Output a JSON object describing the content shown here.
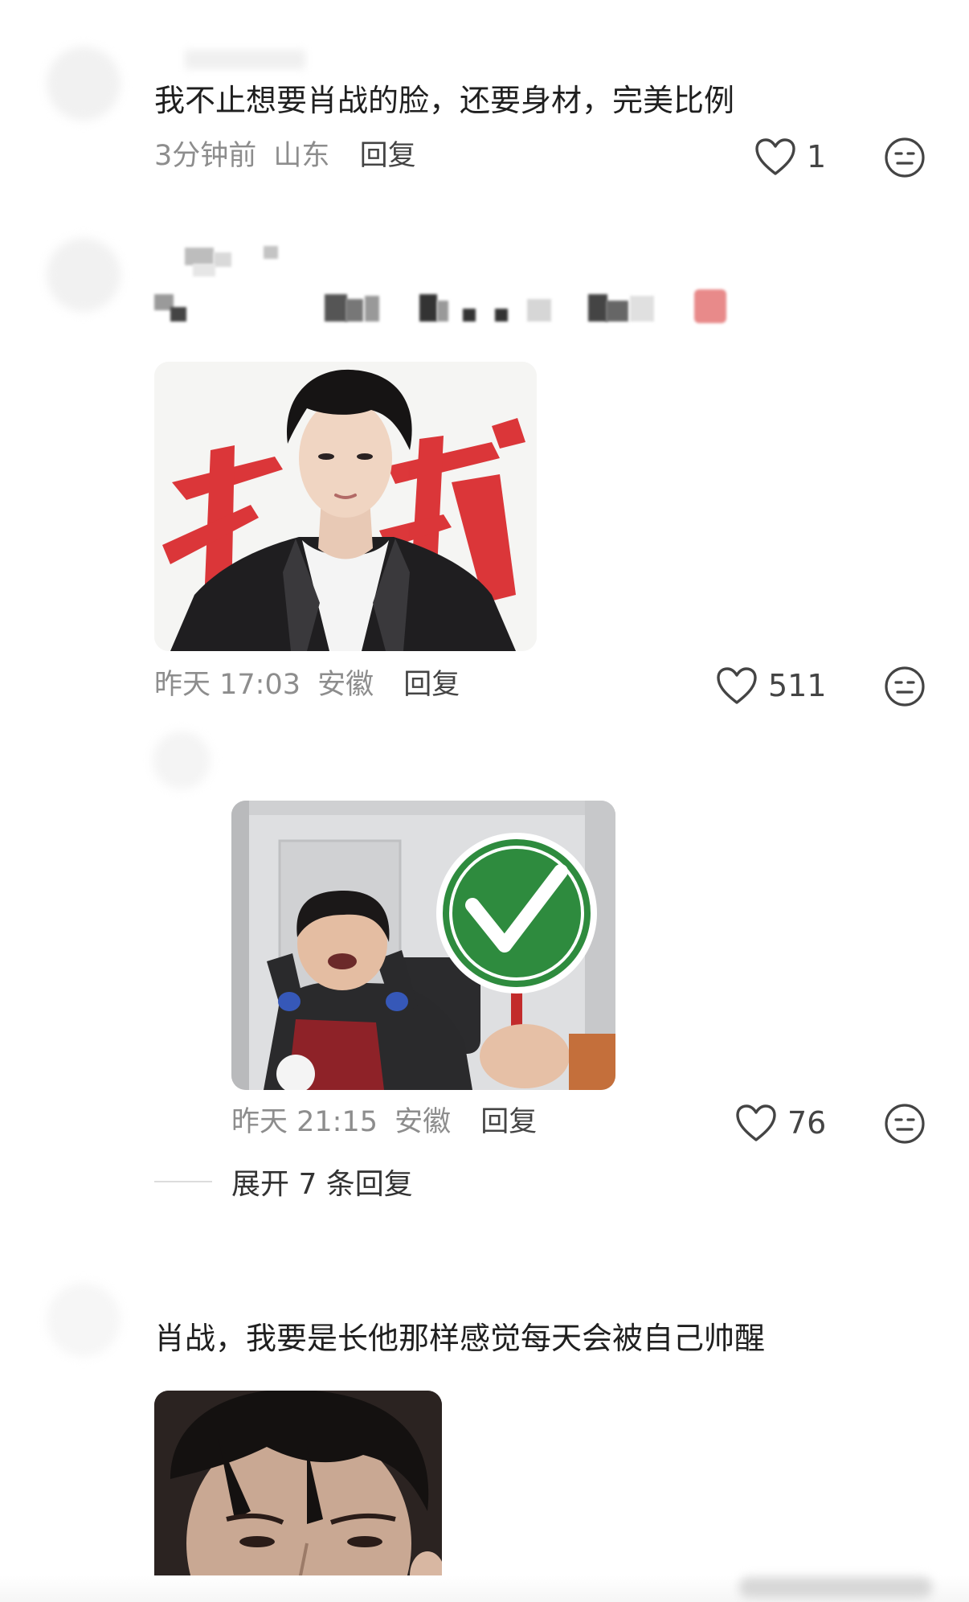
{
  "comments": [
    {
      "text": "我不止想要肖战的脸，还要身材，完美比例",
      "time": "3分钟前",
      "location": "山东",
      "reply": "回复",
      "likes": "1"
    },
    {
      "time": "昨天 17:03",
      "location": "安徽",
      "reply": "回复",
      "likes": "511",
      "image": {
        "red_text": "权威"
      }
    },
    {
      "time": "昨天 21:15",
      "location": "安徽",
      "reply": "回复",
      "likes": "76",
      "expand": "展开 7 条回复"
    },
    {
      "text": "肖战，我要是长他那样感觉每天会被自己帅醒"
    }
  ],
  "icons": {
    "like": "heart-outline-icon",
    "dislike": "expressionless-face-icon",
    "check": "green-check-sign"
  },
  "colors": {
    "meta_gray": "#8d8d8d",
    "check_green": "#2e8b3e",
    "red_brush": "#d9262a"
  }
}
